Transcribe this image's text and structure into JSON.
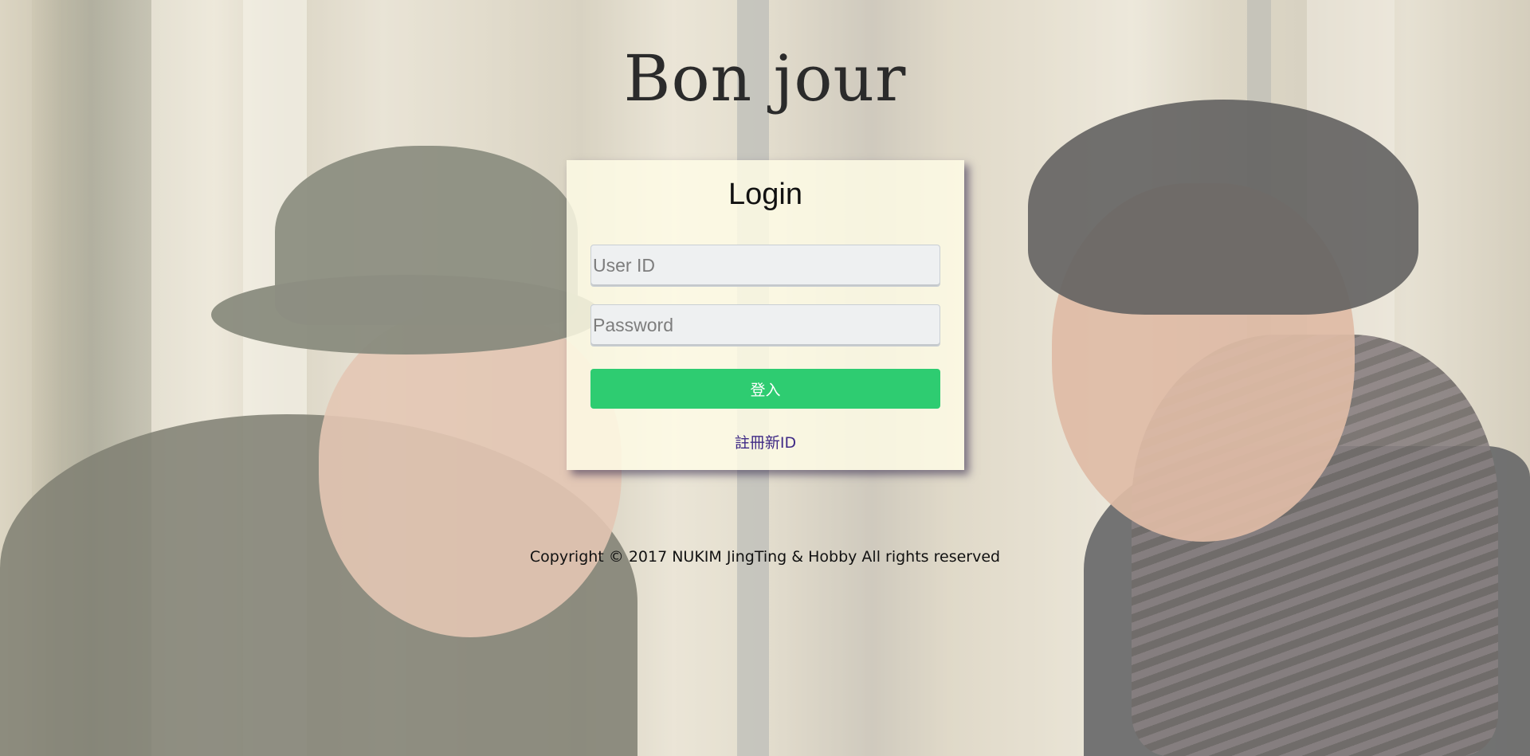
{
  "header": {
    "title": "Bon jour"
  },
  "login": {
    "heading": "Login",
    "user_id_placeholder": "User ID",
    "password_placeholder": "Password",
    "submit_label": "登入",
    "register_label": "註冊新ID"
  },
  "footer": {
    "copyright": "Copyright © 2017 NUKIM JingTing & Hobby All rights reserved"
  },
  "colors": {
    "button_green": "#2ecc71",
    "link_purple": "#3f2a86",
    "card_bg": "#fffde6"
  }
}
